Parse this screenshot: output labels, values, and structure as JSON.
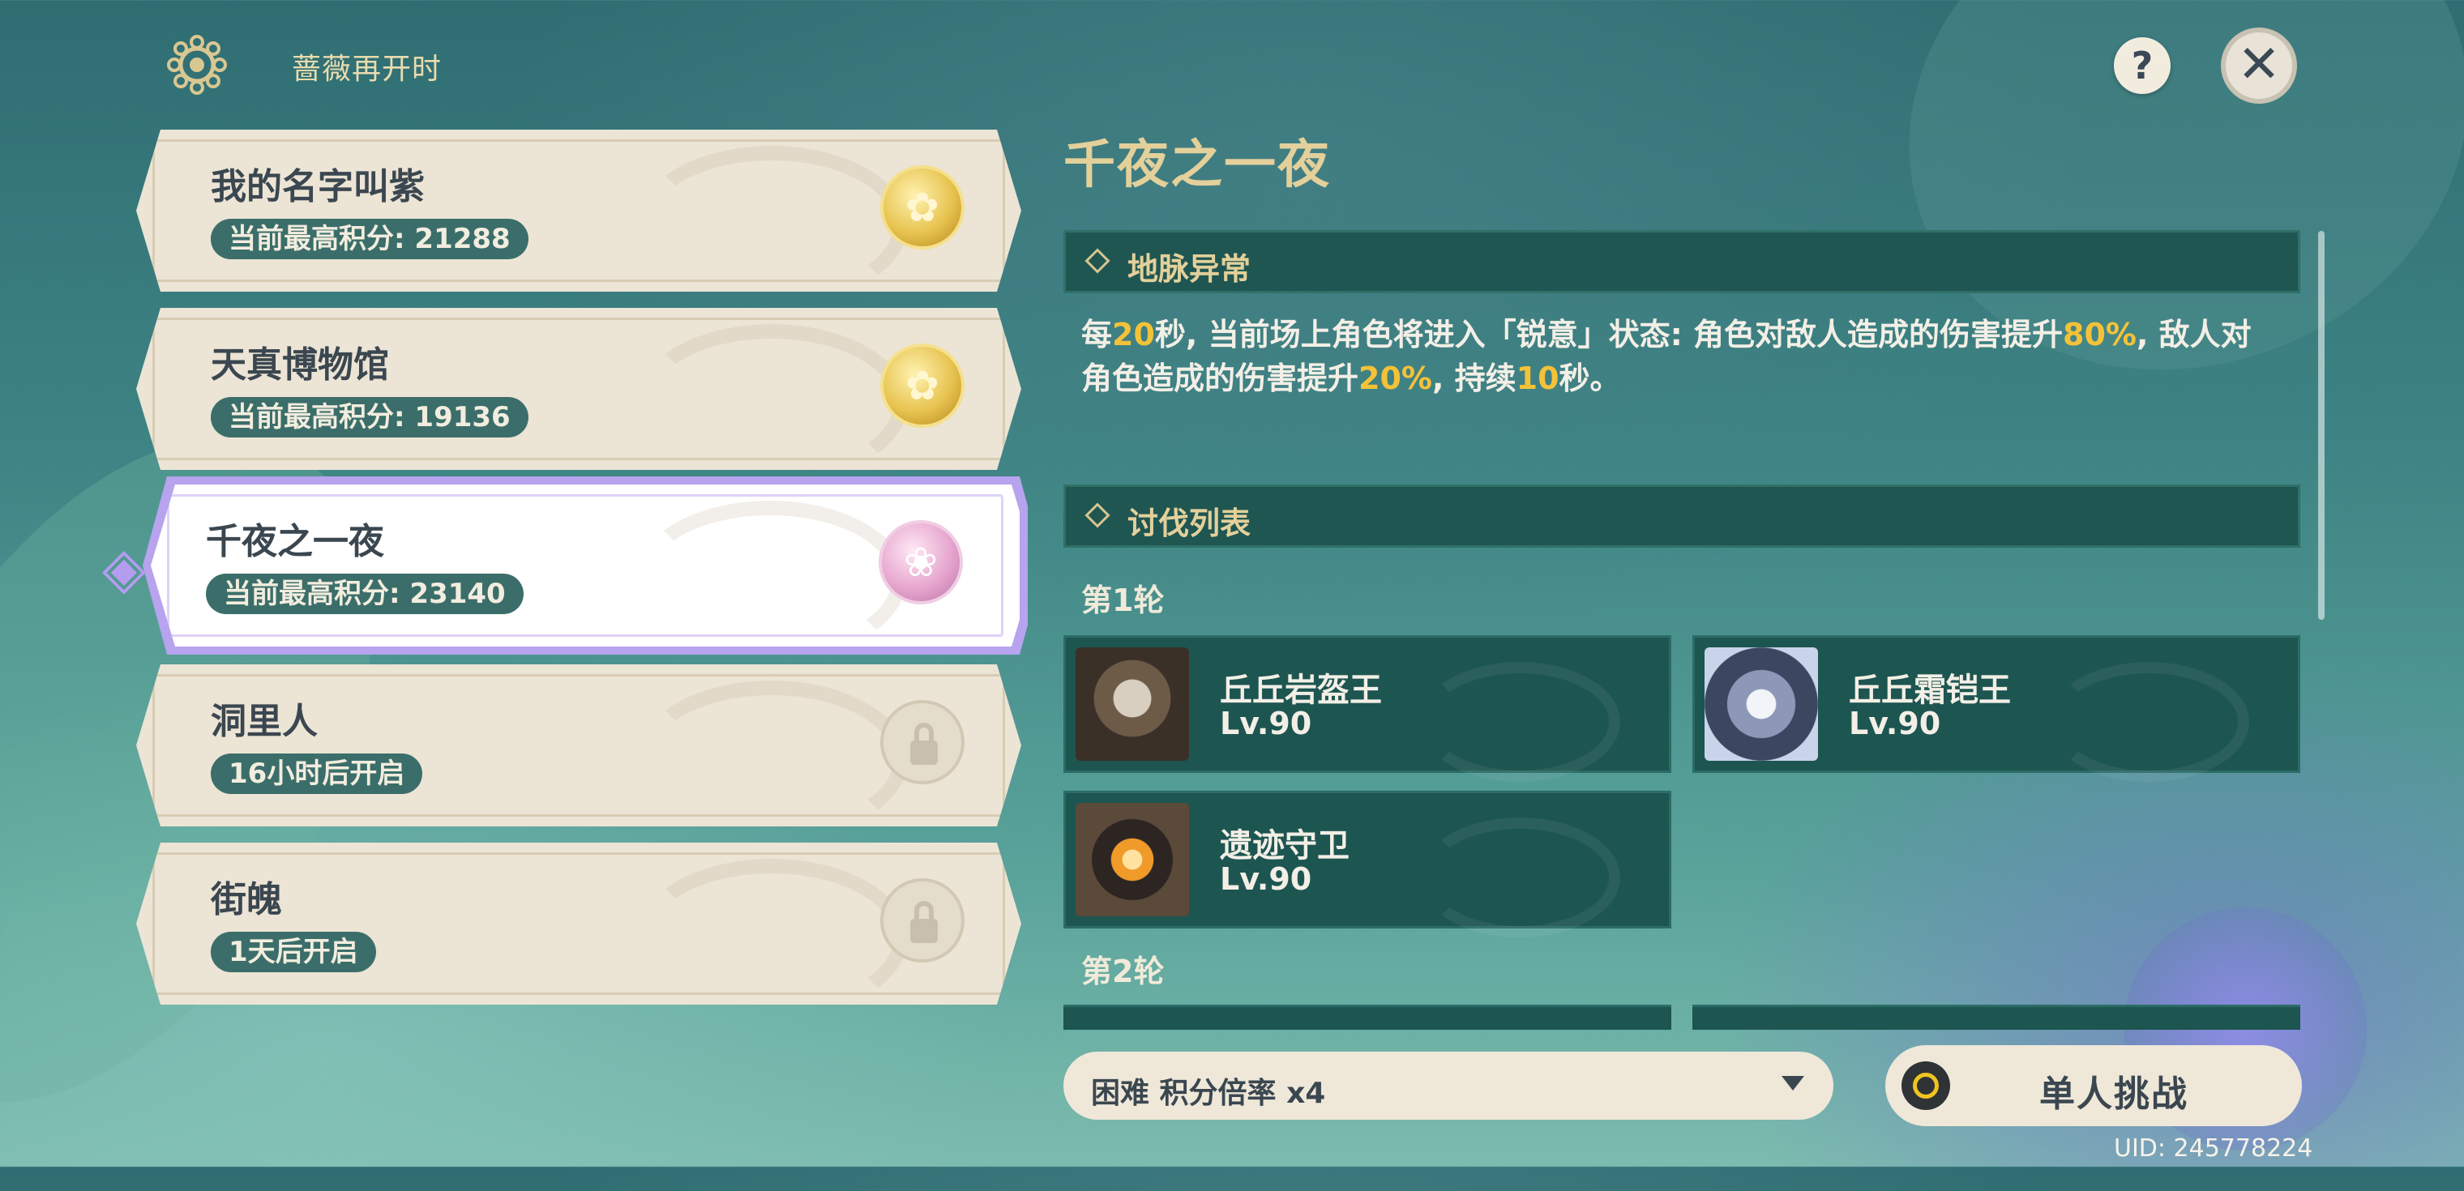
{
  "header": {
    "event_title": "蔷薇再开时",
    "help_label": "?",
    "close_label": "✕"
  },
  "challenges": [
    {
      "name": "我的名字叫紫",
      "score": "当前最高积分: 21288",
      "medal": "gold"
    },
    {
      "name": "天真博物馆",
      "score": "当前最高积分: 19136",
      "medal": "gold"
    },
    {
      "name": "千夜之一夜",
      "score": "当前最高积分: 23140",
      "medal": "pink"
    },
    {
      "name": "洞里人",
      "score": "16小时后开启",
      "medal": "locked"
    },
    {
      "name": "街魄",
      "score": "1天后开启",
      "medal": "locked"
    }
  ],
  "panel": {
    "title": "千夜之一夜",
    "ley_line_label": "地脉异常",
    "desc": {
      "p1": "每",
      "n1": "20",
      "p2": "秒, 当前场上角色将进入「锐意」状态: 角色对敌人造成的伤害提升",
      "n2": "80%",
      "p3": ", 敌人对角色造成的伤害提升",
      "n3": "20%",
      "p4": ", 持续",
      "n4": "10",
      "p5": "秒。"
    },
    "enemy_list_label": "讨伐列表",
    "round1_label": "第1轮",
    "round2_label": "第2轮",
    "enemies": [
      {
        "name": "丘丘岩盔王",
        "level": "Lv.90"
      },
      {
        "name": "丘丘霜铠王",
        "level": "Lv.90"
      },
      {
        "name": "遗迹守卫",
        "level": "Lv.90"
      }
    ]
  },
  "footer": {
    "difficulty": "困难 积分倍率 x4",
    "challenge_button": "单人挑战",
    "uid": "UID: 245778224"
  }
}
